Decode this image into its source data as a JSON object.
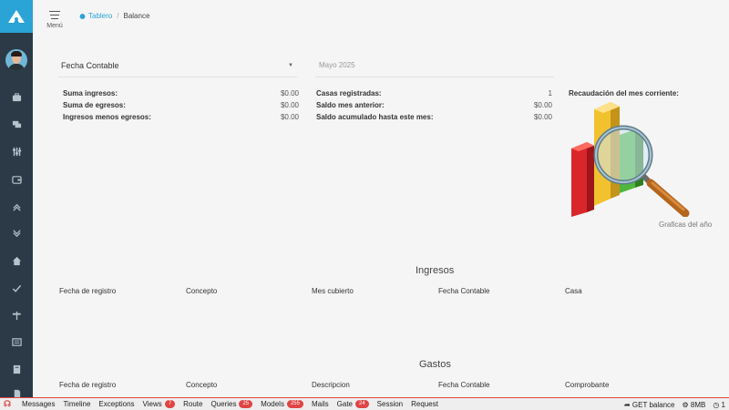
{
  "header": {
    "menu_label": "Menú",
    "breadcrumb_home": "Tablero",
    "breadcrumb_separator": "/",
    "breadcrumb_current": "Balance"
  },
  "filters": {
    "fecha_label": "Fecha Contable",
    "mes_value": "Mayo 2025"
  },
  "summary_left": [
    {
      "label": "Suma ingresos:",
      "value": "$0.00"
    },
    {
      "label": "Suma de egresos:",
      "value": "$0.00"
    },
    {
      "label": "Ingresos menos egresos:",
      "value": "$0.00"
    }
  ],
  "summary_right": [
    {
      "label": "Casas registradas:",
      "value": "1"
    },
    {
      "label": "Saldo mes anterior:",
      "value": "$0.00"
    },
    {
      "label": "Saldo acumulado hasta este mes:",
      "value": "$0.00"
    }
  ],
  "recaudacion_label": "Recaudación del mes corriente:",
  "grafica_caption": "Graficas del año",
  "ingresos": {
    "title": "Ingresos",
    "columns": [
      "Fecha de registro",
      "Concepto",
      "Mes cubierto",
      "Fecha Contable",
      "Casa"
    ]
  },
  "gastos": {
    "title": "Gastos",
    "columns": [
      "Fecha de registro",
      "Concepto",
      "Descripcion",
      "Fecha Contable",
      "Comprobante"
    ]
  },
  "debugbar": {
    "tabs": [
      {
        "label": "Messages"
      },
      {
        "label": "Timeline"
      },
      {
        "label": "Exceptions"
      },
      {
        "label": "Views",
        "badge": "7"
      },
      {
        "label": "Route"
      },
      {
        "label": "Queries",
        "badge": "25"
      },
      {
        "label": "Models",
        "badge": "255"
      },
      {
        "label": "Mails"
      },
      {
        "label": "Gate",
        "badge": "24"
      },
      {
        "label": "Session"
      },
      {
        "label": "Request"
      }
    ],
    "route": "GET balance",
    "memory": "8MB",
    "time": "1"
  },
  "colors": {
    "sidebar": "#2b3a46",
    "accent": "#2aa3d6",
    "debug_red": "#e04444"
  },
  "icons": [
    "logo-icon",
    "briefcase-icon",
    "chat-icon",
    "sliders-icon",
    "wallet-icon",
    "chevrons-up-icon",
    "chevrons-down-icon",
    "home-icon",
    "check-icon",
    "signpost-icon",
    "newspaper-icon",
    "book-icon"
  ]
}
